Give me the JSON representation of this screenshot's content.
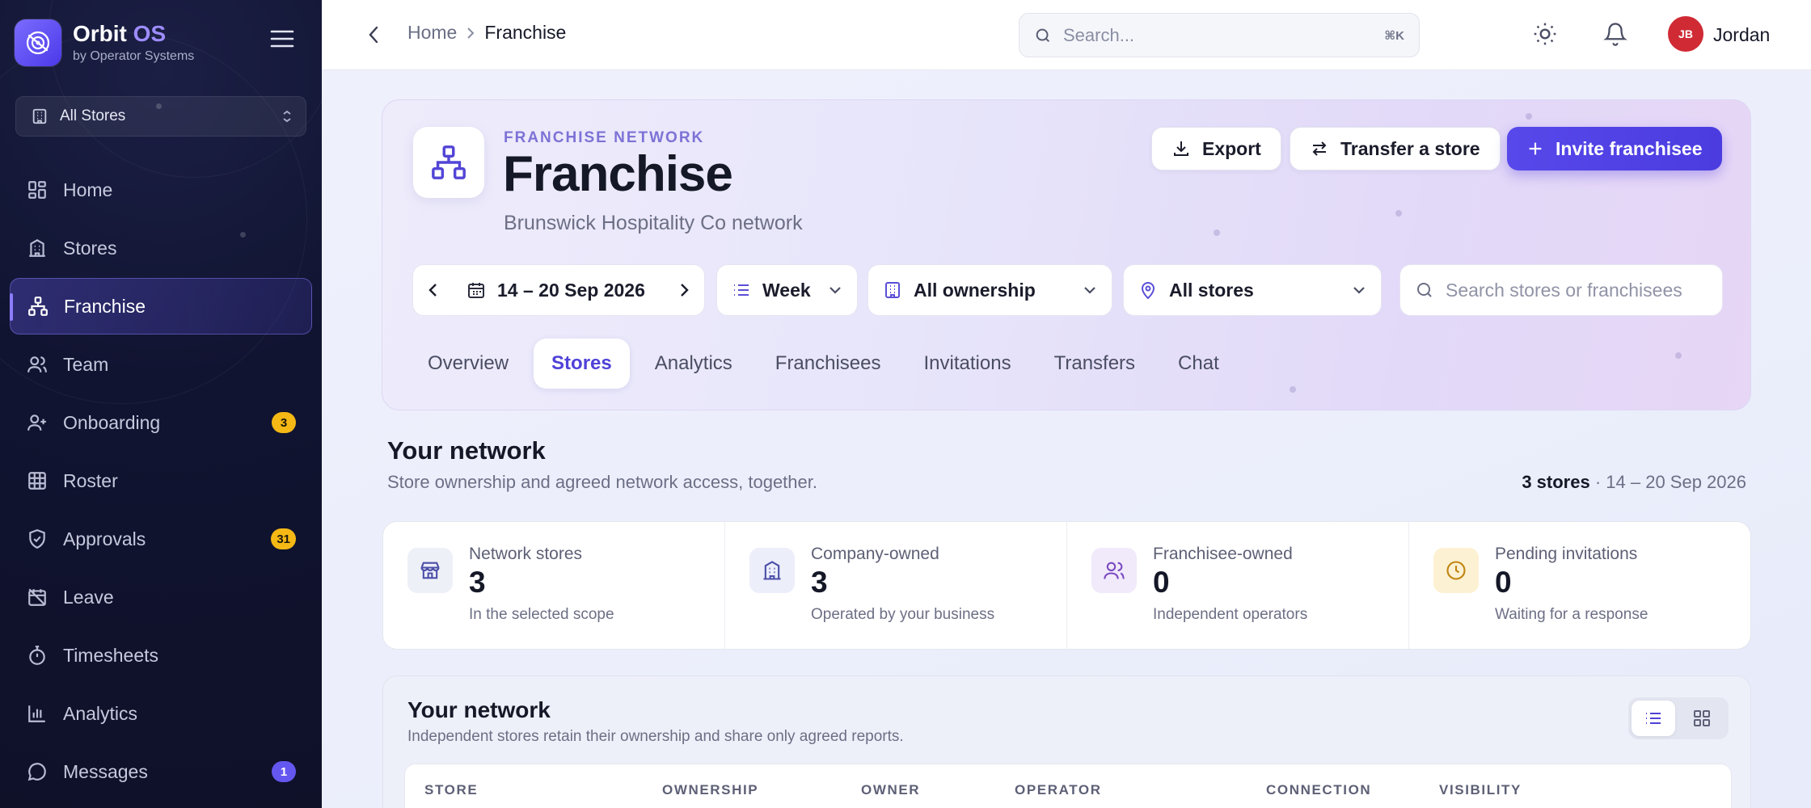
{
  "app": {
    "name": "Orbit",
    "name_accent": "OS",
    "subtitle": "by Operator Systems"
  },
  "store_selector": {
    "label": "All Stores"
  },
  "sidebar": {
    "items": [
      {
        "label": "Home",
        "icon": "home-icon"
      },
      {
        "label": "Stores",
        "icon": "building-icon"
      },
      {
        "label": "Franchise",
        "icon": "network-icon",
        "active": true
      },
      {
        "label": "Team",
        "icon": "users-icon"
      },
      {
        "label": "Onboarding",
        "icon": "user-plus-icon",
        "badge": "3"
      },
      {
        "label": "Roster",
        "icon": "grid-icon"
      },
      {
        "label": "Approvals",
        "icon": "shield-check-icon",
        "badge": "31"
      },
      {
        "label": "Leave",
        "icon": "calendar-off-icon"
      },
      {
        "label": "Timesheets",
        "icon": "stopwatch-icon"
      },
      {
        "label": "Analytics",
        "icon": "bar-chart-icon"
      },
      {
        "label": "Messages",
        "icon": "chat-icon",
        "badge": "1"
      }
    ]
  },
  "topbar": {
    "breadcrumb": [
      "Home",
      "Franchise"
    ],
    "search_placeholder": "Search...",
    "search_shortcut": "⌘K",
    "user_initials": "JB",
    "user_name": "Jordan"
  },
  "hero": {
    "eyebrow": "FRANCHISE NETWORK",
    "title": "Franchise",
    "subtitle": "Brunswick Hospitality Co network",
    "buttons": {
      "export": "Export",
      "transfer": "Transfer a store",
      "invite": "Invite franchisee"
    },
    "filters": {
      "date_range": "14 – 20 Sep 2026",
      "period": "Week",
      "ownership": "All ownership",
      "stores": "All stores",
      "search_placeholder": "Search stores or franchisees"
    },
    "tabs": [
      "Overview",
      "Stores",
      "Analytics",
      "Franchisees",
      "Invitations",
      "Transfers",
      "Chat"
    ],
    "active_tab": "Stores"
  },
  "network_section": {
    "title": "Your network",
    "subtitle": "Store ownership and agreed network access, together.",
    "meta_count": "3 stores",
    "meta_sep": " · ",
    "meta_range": "14 – 20 Sep 2026"
  },
  "stats": [
    {
      "label": "Network stores",
      "value": "3",
      "note": "In the selected scope",
      "icon": "store-icon",
      "tint": "#eef0f8",
      "color": "#4b4fa8"
    },
    {
      "label": "Company-owned",
      "value": "3",
      "note": "Operated by your business",
      "icon": "building-icon",
      "tint": "#eceefa",
      "color": "#4b4fa8"
    },
    {
      "label": "Franchisee-owned",
      "value": "0",
      "note": "Independent operators",
      "icon": "users-icon",
      "tint": "#f1eafb",
      "color": "#7a4bc0"
    },
    {
      "label": "Pending invitations",
      "value": "0",
      "note": "Waiting for a response",
      "icon": "clock-icon",
      "tint": "#fcf1d2",
      "color": "#c08410"
    }
  ],
  "network_table": {
    "title": "Your network",
    "subtitle": "Independent stores retain their ownership and share only agreed reports.",
    "columns": [
      "STORE",
      "OWNERSHIP",
      "OWNER",
      "OPERATOR",
      "CONNECTION",
      "VISIBILITY"
    ]
  },
  "colors": {
    "sidebar_bg": "#111431",
    "accent": "#5748ea",
    "badge_yellow": "#f5b814",
    "badge_purple": "#6457f0",
    "avatar": "#d02b35"
  }
}
